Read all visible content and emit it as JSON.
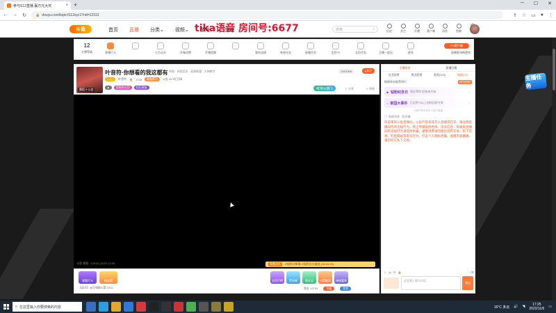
{
  "browser": {
    "tab_title": "参与S12直播 赢万元大奖",
    "url": "douyu.com/topic/S12syc1?rid=12313"
  },
  "overlay": {
    "text": "tika语音 房间号:6677"
  },
  "header": {
    "logo": "斗鱼",
    "nav": [
      "首页",
      "直播",
      "分类",
      "视频",
      "游戏",
      "鱼吧"
    ],
    "search_placeholder": "搜索",
    "tools": [
      "历史",
      "关注",
      "开播",
      "客户端",
      "消息",
      "鱼粮",
      "会员"
    ]
  },
  "activity_bar": {
    "level": "12",
    "level_label": "主播等级",
    "items": [
      "直播打卡",
      "",
      "火力全开",
      "开箱消费",
      "开播提醒",
      "",
      "我的战绩",
      "有效任务",
      "星耀任务",
      "全民PK",
      "全民任务",
      "主播一起玩",
      "更多"
    ],
    "pc_button": "PC客户端",
    "pc_sub": "直播更流畅更快"
  },
  "stream": {
    "title": "叶音符·你想看的我这都有",
    "category": "举报",
    "sub_category": "网游竞技 · 英雄联盟 · 大神教学",
    "anchor_name": "叶音符",
    "hot": "1716",
    "meta_extra": "公告:1V1亿万场",
    "followers": "3431906",
    "follow_label": "关注",
    "vote_label": "可冲火箭 1",
    "share": "分享",
    "report": "举报",
    "rank_tag": "舞蹈 9 公会",
    "badges": [
      "LV21",
      "最强黑马",
      "超级粉丝团",
      "钻石贵族"
    ],
    "timestamp": "斗鱼 视频 - 12313 | 2022.11.06",
    "promo_tag": "观看送礼",
    "promo_text": "2倍积分掉落+2倍积分大放送 (05:34:22)"
  },
  "gift_bar": {
    "left": [
      "观看打卡",
      "粉丝团"
    ],
    "note": "【虎牙】@可领取火箭 3111",
    "mid": [
      "全民打榜",
      "荧光棒",
      "鱼丸宝",
      "火箭推荐",
      "神秘嘉宾"
    ],
    "fish_label": "鱼丸 13743",
    "buttons": [
      "充值",
      "背包"
    ]
  },
  "side": {
    "tabs": [
      "主播排名",
      "直播回看"
    ],
    "sub_tabs": [
      "日活跃榜",
      "周活跃榜",
      "贵宾(145)",
      "钻粉(77)"
    ],
    "rank_note": "按照排名推荐排行",
    "rank_action": "成为钻粉",
    "events": [
      {
        "name": "钻粉纪念日",
        "desc": "我在等你 赶快来开始"
      },
      {
        "name": "家园大事件",
        "desc": "已达到75以上钻粉回款专享"
      }
    ],
    "side_note": "斗鱼严禁未成年人进行直播",
    "sys_head": "系统消息 · 防诈骗",
    "sys_msg": "欢迎来到斗鱼直播间，斗鱼严禁未成年人直播或打赏，请注意直播间内的违规行为，禁止传播低俗色情、违法信息，如发现直播间有违规行为请及时举报，谨慎消费请勿相信场外交易，私下交易、钓鱼网站等欺诈行为，打击个人隐私泄露，直播内容健康、请勿轻信私下交易。",
    "chat_placeholder": "这里输入聊天内容",
    "send": "发送"
  },
  "float_badge": "主播任务",
  "taskbar": {
    "search": "在这里输入你要搜索的内容",
    "weather": "16°C 多云",
    "time": "17:25",
    "date": "2022/11/6"
  }
}
